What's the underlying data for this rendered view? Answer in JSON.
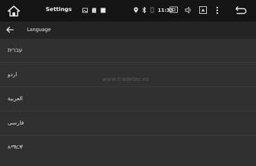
{
  "statusbar": {
    "title": "Settings",
    "time": "11:33"
  },
  "appbar": {
    "title": "Language"
  },
  "languages": [
    {
      "label": "עברית"
    },
    {
      "label": "اردو"
    },
    {
      "label": "العربية"
    },
    {
      "label": "فارسی"
    },
    {
      "label": "አማርኛ"
    }
  ],
  "watermark": "www.tradetec.es",
  "icons": {
    "home": "home-icon",
    "back": "back-arrow-icon",
    "return": "return-icon",
    "menu": "overflow-menu-icon"
  }
}
